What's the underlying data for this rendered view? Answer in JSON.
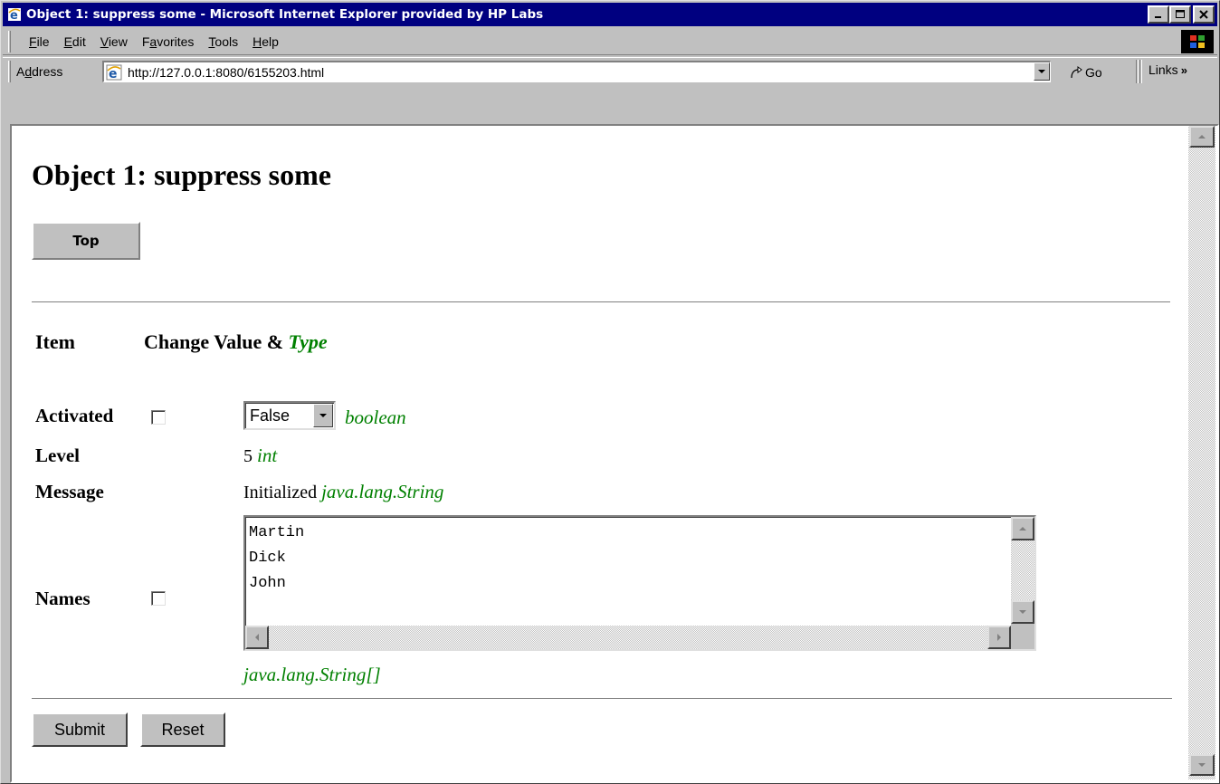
{
  "window": {
    "title": "Object 1: suppress some - Microsoft Internet Explorer provided by HP Labs"
  },
  "menu": {
    "items": [
      {
        "pre": "",
        "key": "F",
        "post": "ile"
      },
      {
        "pre": "",
        "key": "E",
        "post": "dit"
      },
      {
        "pre": "",
        "key": "V",
        "post": "iew"
      },
      {
        "pre": "F",
        "key": "a",
        "post": "vorites"
      },
      {
        "pre": "",
        "key": "T",
        "post": "ools"
      },
      {
        "pre": "",
        "key": "H",
        "post": "elp"
      }
    ]
  },
  "address": {
    "label_pre": "A",
    "label_key": "d",
    "label_post": "dress",
    "url": "http://127.0.0.1:8080/6155203.html",
    "go_label": "Go",
    "links_label": "Links",
    "links_chevron": "»"
  },
  "page": {
    "title": "Object 1: suppress some",
    "top_button": "Top",
    "header": {
      "item": "Item",
      "change_value": "Change Value & ",
      "type": "Type"
    },
    "rows": {
      "activated": {
        "label": "Activated",
        "select_value": "False",
        "type": "boolean"
      },
      "level": {
        "label": "Level",
        "value": "5",
        "type": "int"
      },
      "message": {
        "label": "Message",
        "value": "Initialized",
        "type": "java.lang.String"
      },
      "names": {
        "label": "Names",
        "lines": [
          "Martin",
          "Dick",
          "John"
        ],
        "type": "java.lang.String[]"
      }
    },
    "submit_label": "Submit",
    "reset_label": "Reset"
  },
  "colors": {
    "titlebar": "#000080",
    "type_green": "#008000",
    "chrome": "#c0c0c0"
  }
}
